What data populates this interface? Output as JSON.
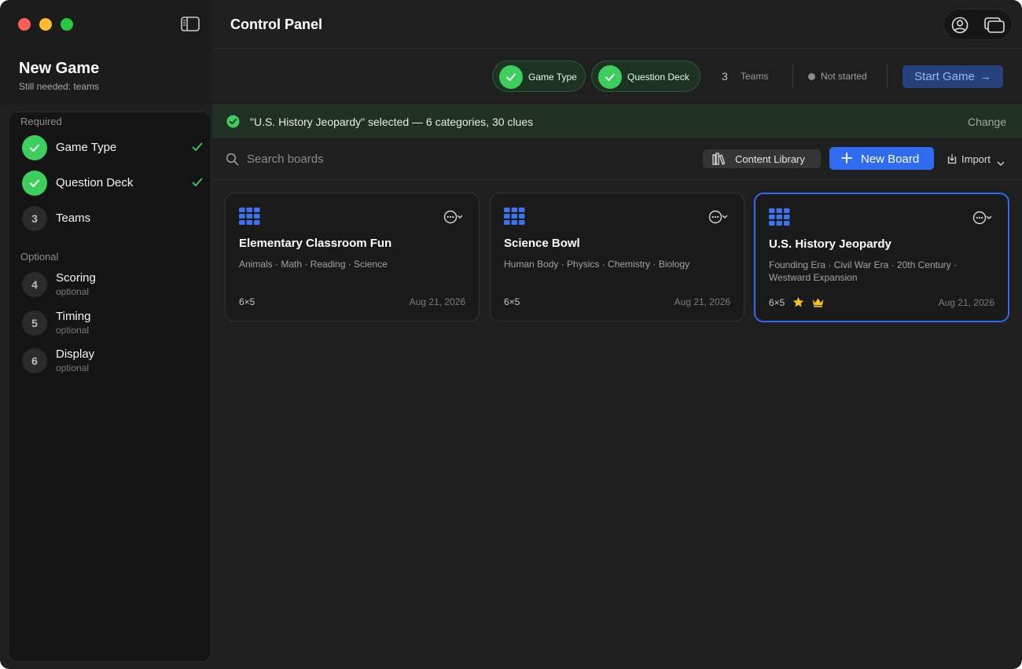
{
  "window": {
    "title": "Control Panel"
  },
  "game": {
    "title": "New Game",
    "subtitle": "Still needed: teams"
  },
  "sidebar": {
    "required_label": "Required",
    "optional_label": "Optional",
    "steps": [
      {
        "number": "1",
        "label": "Game Type",
        "sub": "",
        "status": "done"
      },
      {
        "number": "2",
        "label": "Question Deck",
        "sub": "",
        "status": "done"
      },
      {
        "number": "3",
        "label": "Teams",
        "sub": "",
        "status": "todo"
      },
      {
        "number": "4",
        "label": "Scoring",
        "sub": "optional",
        "status": "todo"
      },
      {
        "number": "5",
        "label": "Timing",
        "sub": "optional",
        "status": "todo"
      },
      {
        "number": "6",
        "label": "Display",
        "sub": "optional",
        "status": "todo"
      }
    ]
  },
  "statusbar": {
    "pills": [
      {
        "label": "Game Type"
      },
      {
        "label": "Question Deck"
      }
    ],
    "teams_count": "3",
    "teams_label": "Teams",
    "status": "Not started",
    "start_label": "Start Game",
    "arrow": "→"
  },
  "banner": {
    "text": "\"U.S. History Jeopardy\" selected — 6 categories, 30 clues",
    "change_label": "Change"
  },
  "toolbar": {
    "search_placeholder": "Search boards",
    "library_label": "Content Library",
    "new_board_label": "New Board",
    "import_label": "Import"
  },
  "boards": [
    {
      "title": "Elementary Classroom Fun",
      "categories": "Animals · Math · Reading · Science",
      "size": "6×5",
      "date": "Aug 21, 2026",
      "selected": false
    },
    {
      "title": "Science Bowl",
      "categories": "Human Body · Physics · Chemistry · Biology",
      "size": "6×5",
      "date": "Aug 21, 2026",
      "selected": false
    },
    {
      "title": "U.S. History Jeopardy",
      "categories": "Founding Era · Civil War Era · 20th Century · Westward Expansion",
      "size": "6×5",
      "date": "Aug 21, 2026",
      "selected": true,
      "badges": [
        "star-icon",
        "crown-icon"
      ]
    }
  ],
  "colors": {
    "accent": "#2f6bf0",
    "success": "#3ccf5d",
    "window_bg": "#1f1f1f",
    "sidebar_bg": "#141414",
    "star": "#f7c325"
  }
}
